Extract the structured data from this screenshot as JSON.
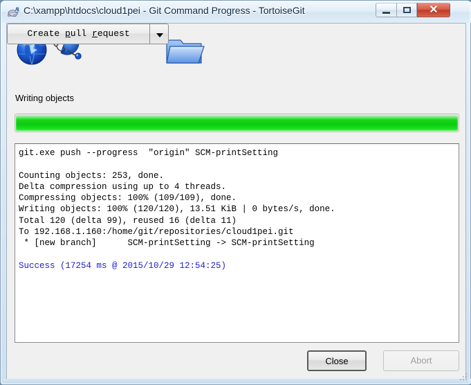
{
  "window": {
    "title": "C:\\xampp\\htdocs\\cloud1pei - Git Command Progress - TortoiseGit",
    "icon": "tortoisegit-turtle-icon",
    "controls": {
      "minimize_label": "–",
      "maximize_label": "□",
      "close_label": "✕"
    }
  },
  "animation": {
    "left_globe": "blue-globe-icon",
    "right_globe": "blue-globe-transfer-icon",
    "folder": "blue-folder-icon"
  },
  "status": {
    "label": "Writing objects"
  },
  "progress": {
    "percent": 100,
    "fill_color": "#0ccb10",
    "track_color": "#e9e9e9"
  },
  "log": {
    "lines": [
      "git.exe push --progress  \"origin\" SCM-printSetting",
      "",
      "Counting objects: 253, done.",
      "Delta compression using up to 4 threads.",
      "Compressing objects: 100% (109/109), done.",
      "Writing objects: 100% (120/120), 13.51 KiB | 0 bytes/s, done.",
      "Total 120 (delta 99), reused 16 (delta 11)",
      "To 192.168.1.160:/home/git/repositories/cloud1pei.git",
      " * [new branch]      SCM-printSetting -> SCM-printSetting",
      ""
    ],
    "success_line": "Success (17254 ms @ 2015/10/29 12:54:25)",
    "success_color": "#2222cc"
  },
  "buttons": {
    "create_pull_request": {
      "text_before": "Create ",
      "accel_p": "p",
      "text_middle": "ull ",
      "accel_r": "r",
      "text_after": "equest",
      "full_label": "Create pull request",
      "dropdown": "chevron-down-icon"
    },
    "close": {
      "label": "Close",
      "default": true
    },
    "abort": {
      "label": "Abort",
      "disabled": true
    }
  }
}
